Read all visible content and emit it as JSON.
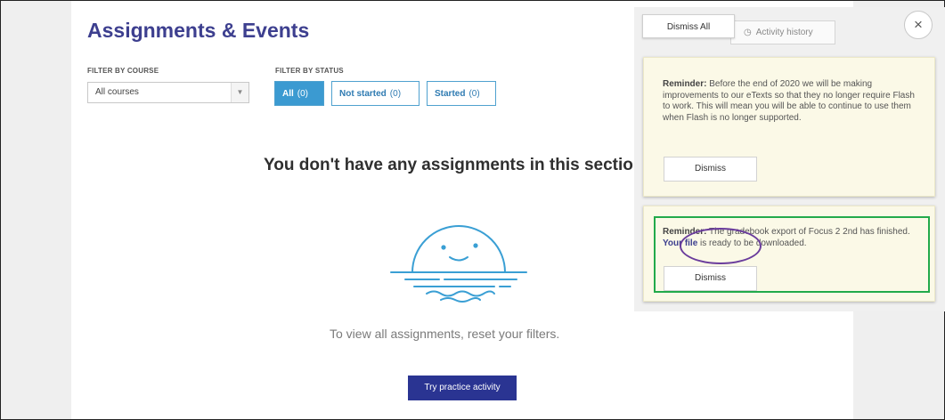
{
  "page": {
    "title": "Assignments & Events"
  },
  "filters": {
    "course_label": "FILTER BY COURSE",
    "course_value": "All courses",
    "status_label": "FILTER BY STATUS",
    "status_buttons": [
      {
        "label": "All",
        "count": "(0)",
        "active": true
      },
      {
        "label": "Not started",
        "count": "(0)",
        "active": false
      },
      {
        "label": "Started",
        "count": "(0)",
        "active": false
      }
    ]
  },
  "empty_state": {
    "title": "You don't have any assignments in this sectio",
    "subtitle": "To view all assignments, reset your filters.",
    "practice_button": "Try practice activity"
  },
  "notifications": {
    "dismiss_all": "Dismiss All",
    "activity_history": "Activity history",
    "close": "×",
    "cards": [
      {
        "prefix": "Reminder:",
        "text": " Before the end of 2020 we will be making improvements to our eTexts so that they no longer require Flash to work. This will mean you will be able to continue to use them when Flash is no longer supported.",
        "dismiss": "Dismiss"
      },
      {
        "prefix": "Reminder:",
        "text_before": " The gradebook export of Focus 2 2nd has finished. ",
        "link": "Your file",
        "text_after": " is ready to be downloaded.",
        "dismiss": "Dismiss"
      }
    ]
  },
  "colors": {
    "title": "#3d3f8f",
    "active_filter": "#3b9ad1",
    "practice_button": "#2a3492",
    "card_bg": "#fbf9e7",
    "highlight_box": "#22aa4b",
    "highlight_ellipse": "#6a3c9c",
    "illustration": "#3a9fd4"
  },
  "icons": {
    "close": "close-icon",
    "history": "clock-icon",
    "dropdown": "chevron-down-icon",
    "illustration": "sunset-smile-icon"
  }
}
